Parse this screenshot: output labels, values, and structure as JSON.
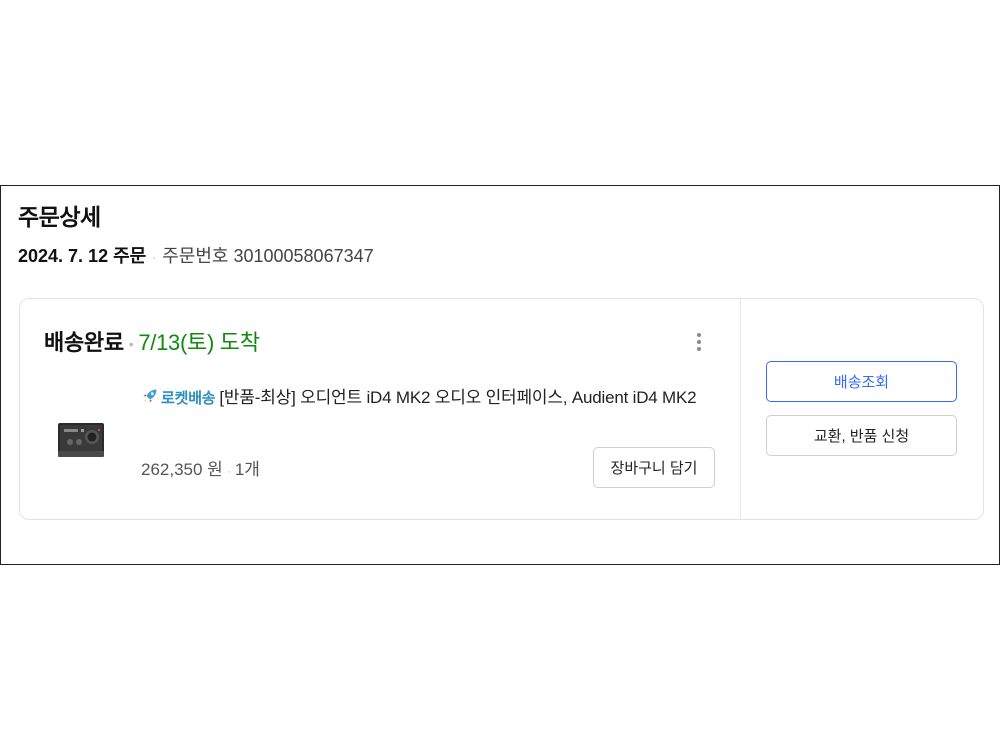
{
  "page": {
    "title": "주문상세"
  },
  "order": {
    "date_label": "2024. 7. 12 주문",
    "separator": "·",
    "number_label": "주문번호",
    "number": "30100058067347"
  },
  "shipment": {
    "status": "배송완료",
    "separator": "•",
    "arrival": "7/13(토) 도착",
    "more_icon": "more-vertical-icon",
    "arrival_color": "#0f8a0f"
  },
  "product": {
    "badge_icon": "rocket-icon",
    "badge_label": "로켓배송",
    "badge_color": "#2a8fbf",
    "name": "[반품-최상] 오디언트 iD4 MK2 오디오 인터페이스, Audient iD4 MK2",
    "price": "262,350 원",
    "separator": "·",
    "quantity": "1개",
    "thumbnail_icon": "audio-interface-image"
  },
  "actions": {
    "cart_label": "장바구니 담기",
    "track_label": "배송조회",
    "return_label": "교환, 반품 신청",
    "accent_color": "#346aff"
  }
}
